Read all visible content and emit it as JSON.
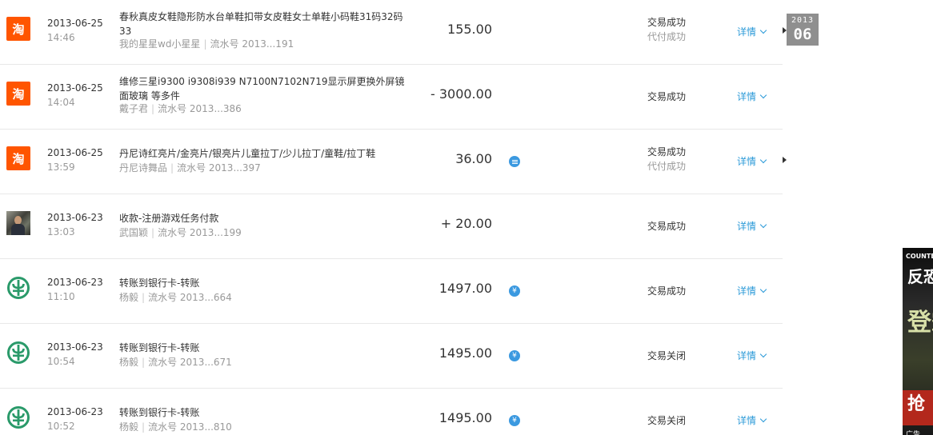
{
  "date_marker": {
    "year": "2013",
    "month": "06"
  },
  "records": [
    {
      "icon": "taobao-icon",
      "icon_glyph": "淘",
      "date": "2013-06-25",
      "time": "14:46",
      "title": "春秋真皮女鞋隐形防水台单鞋扣带女皮鞋女士单鞋小码鞋31码32码33",
      "party": "我的星星wd小星星",
      "serial_label": "流水号",
      "serial": "2013...191",
      "amount": "155.00",
      "status": "交易成功",
      "status_sub": "代付成功",
      "detail": "详情"
    },
    {
      "icon": "taobao-icon",
      "icon_glyph": "淘",
      "date": "2013-06-25",
      "time": "14:04",
      "title": "维修三星i9300 i9308i939 N7100N7102N719显示屏更换外屏镜面玻璃 等多件",
      "party": "戴子君",
      "serial_label": "流水号",
      "serial": "2013...386",
      "amount": "- 3000.00",
      "status": "交易成功",
      "detail": "详情"
    },
    {
      "icon": "taobao-icon",
      "icon_glyph": "淘",
      "date": "2013-06-25",
      "time": "13:59",
      "title": "丹尼诗红亮片/金亮片/银亮片儿童拉丁/少儿拉丁/童鞋/拉丁鞋",
      "party": "丹尼诗舞品",
      "serial_label": "流水号",
      "serial": "2013...397",
      "amount": "36.00",
      "badge": "menu-icon",
      "status": "交易成功",
      "status_sub": "代付成功",
      "detail": "详情"
    },
    {
      "icon": "avatar",
      "date": "2013-06-23",
      "time": "13:03",
      "title": "收款-注册游戏任务付款",
      "party": "武国颖",
      "serial_label": "流水号",
      "serial": "2013...199",
      "amount": "+ 20.00",
      "status": "交易成功",
      "detail": "详情"
    },
    {
      "icon": "bank-icon",
      "date": "2013-06-23",
      "time": "11:10",
      "title": "转账到银行卡-转账",
      "party": "杨毅",
      "serial_label": "流水号",
      "serial": "2013...664",
      "amount": "1497.00",
      "badge": "yuan-icon",
      "badge_glyph": "¥",
      "status": "交易成功",
      "detail": "详情"
    },
    {
      "icon": "bank-icon",
      "date": "2013-06-23",
      "time": "10:54",
      "title": "转账到银行卡-转账",
      "party": "杨毅",
      "serial_label": "流水号",
      "serial": "2013...671",
      "amount": "1495.00",
      "badge": "yuan-icon",
      "badge_glyph": "¥",
      "status": "交易关闭",
      "detail": "详情"
    },
    {
      "icon": "bank-icon",
      "date": "2013-06-23",
      "time": "10:52",
      "title": "转账到银行卡-转账",
      "party": "杨毅",
      "serial_label": "流水号",
      "serial": "2013...810",
      "amount": "1495.00",
      "badge": "yuan-icon",
      "badge_glyph": "¥",
      "status": "交易关闭",
      "detail": "详情"
    }
  ],
  "side_ad": {
    "brand": "COUNTER",
    "title": "反恐",
    "big_text": "登霸",
    "stripe_text": "抢",
    "footer": "广告"
  },
  "colors": {
    "taobao_orange": "#ff5500",
    "bank_green": "#2a9a6a",
    "link_blue": "#2b9ad8",
    "badge_blue": "#3b99e0"
  }
}
